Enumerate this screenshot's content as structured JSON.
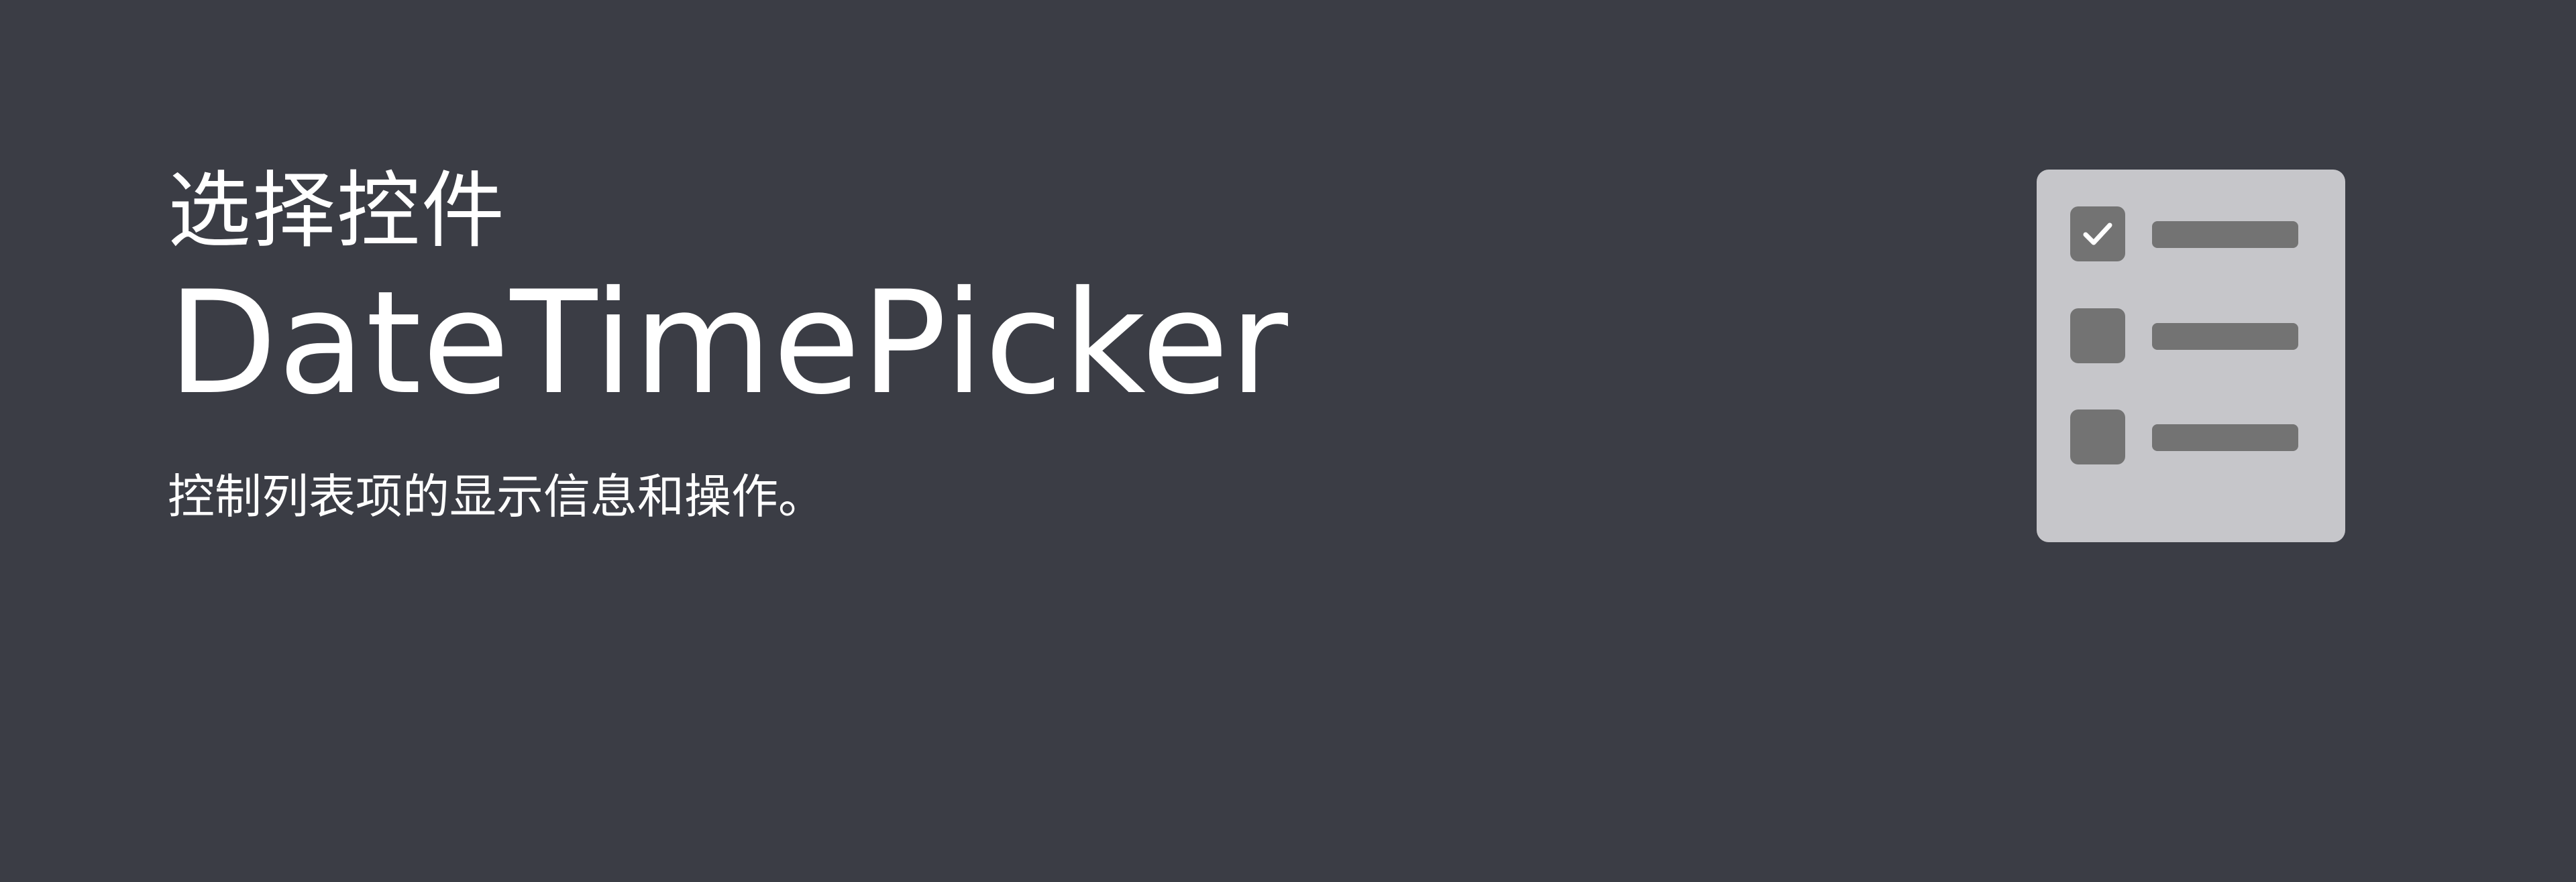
{
  "banner": {
    "category": "选择控件",
    "title": "DateTimePicker",
    "description": "控制列表项的显示信息和操作。",
    "background_color": "#3b3d45",
    "text_color": "#ffffff"
  },
  "illustration": {
    "icon": "checklist-icon",
    "panel_color": "#c6c6ca",
    "item_color": "#737373",
    "items": [
      {
        "checked": true
      },
      {
        "checked": false
      },
      {
        "checked": false
      }
    ]
  }
}
